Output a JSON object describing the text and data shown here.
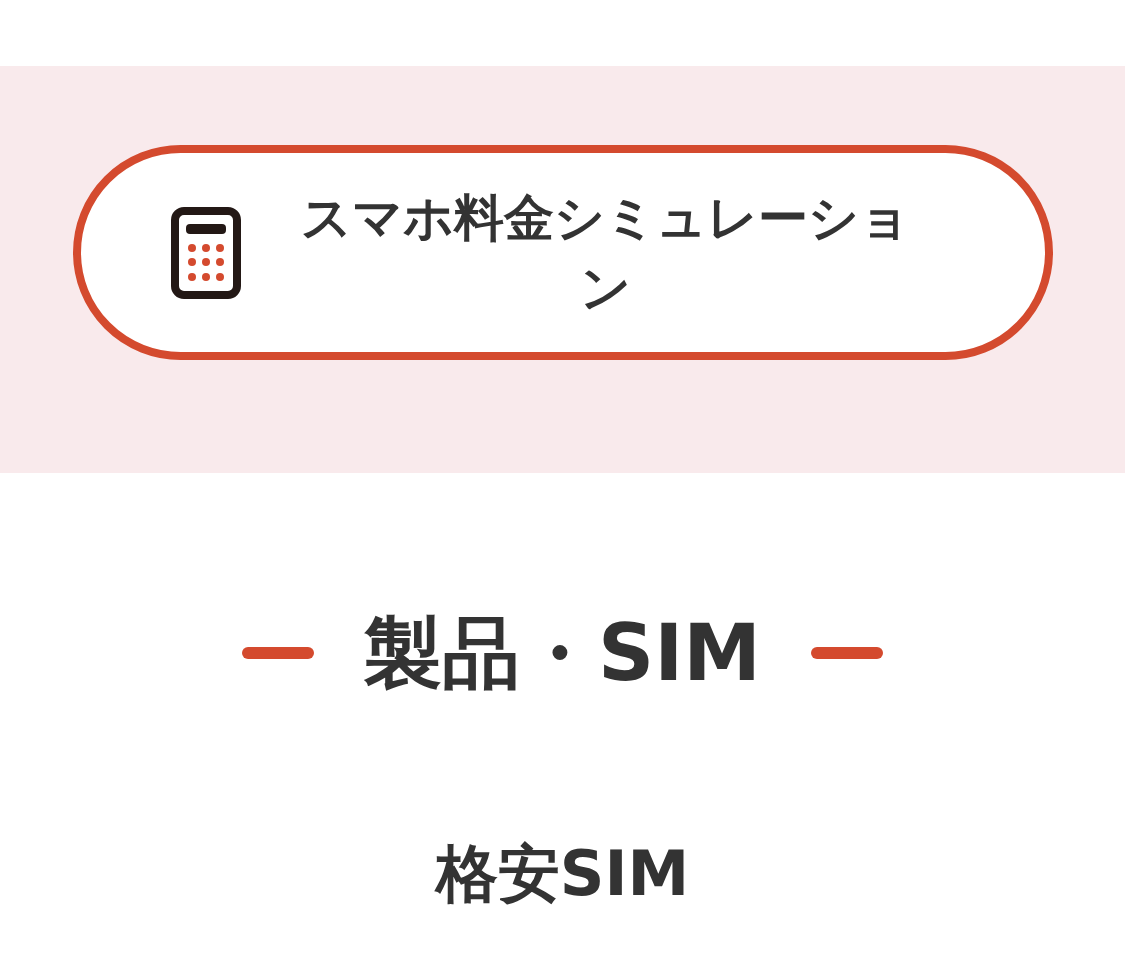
{
  "banner": {
    "button": {
      "label": "スマホ料金シミュレーション"
    }
  },
  "section": {
    "title": "製品・SIM"
  },
  "items": [
    {
      "label": "格安SIM"
    }
  ]
}
